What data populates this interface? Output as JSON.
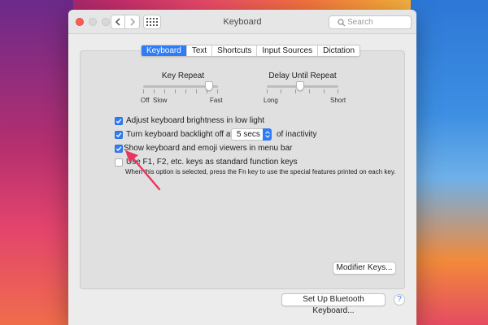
{
  "window": {
    "title": "Keyboard",
    "search_placeholder": "Search"
  },
  "tabs": [
    {
      "label": "Keyboard",
      "selected": true
    },
    {
      "label": "Text",
      "selected": false
    },
    {
      "label": "Shortcuts",
      "selected": false
    },
    {
      "label": "Input Sources",
      "selected": false
    },
    {
      "label": "Dictation",
      "selected": false
    }
  ],
  "key_repeat": {
    "title": "Key Repeat",
    "label_off": "Off",
    "label_slow": "Slow",
    "label_fast": "Fast",
    "value_fraction": 0.88
  },
  "delay_until_repeat": {
    "title": "Delay Until Repeat",
    "label_long": "Long",
    "label_short": "Short",
    "value_fraction": 0.47
  },
  "options": [
    {
      "label": "Adjust keyboard brightness in low light",
      "checked": true
    },
    {
      "label": "Turn keyboard backlight off after",
      "checked": true,
      "select_value": "5 secs",
      "suffix": "of inactivity"
    },
    {
      "label": "Show keyboard and emoji viewers in menu bar",
      "checked": true
    },
    {
      "label": "Use F1, F2, etc. keys as standard function keys",
      "checked": false,
      "note": "When this option is selected, press the Fn key to use the special features printed on each key."
    }
  ],
  "buttons": {
    "modifier_keys": "Modifier Keys...",
    "bluetooth": "Set Up Bluetooth Keyboard...",
    "help": "?"
  },
  "colors": {
    "accent": "#2f7cf6",
    "arrow": "#e8365f"
  }
}
